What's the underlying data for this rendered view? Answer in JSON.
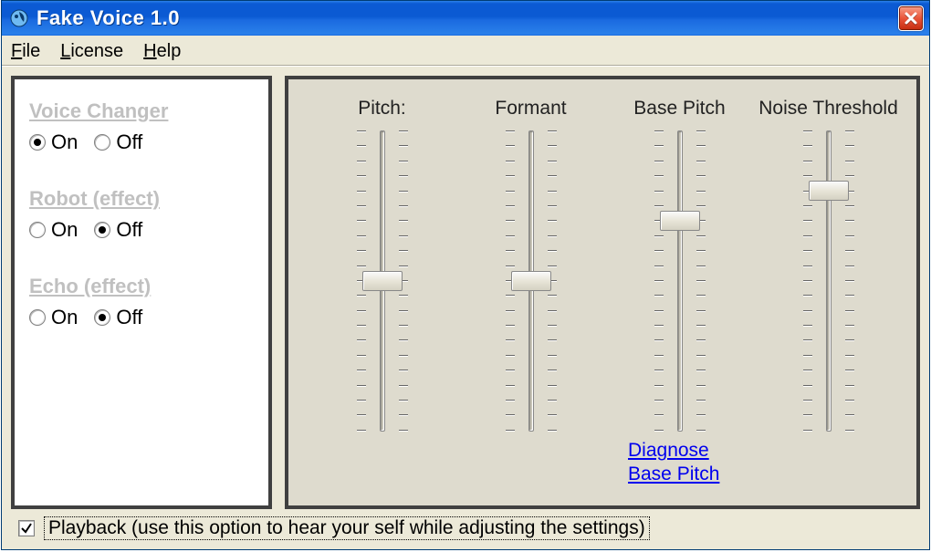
{
  "window": {
    "title": "Fake Voice 1.0"
  },
  "menu": {
    "file": "File",
    "license": "License",
    "help": "Help"
  },
  "left": {
    "voice_changer": {
      "title": "Voice Changer",
      "on": "On",
      "off": "Off",
      "value": "on"
    },
    "robot": {
      "title": "Robot (effect)",
      "on": "On",
      "off": "Off",
      "value": "off"
    },
    "echo": {
      "title": "Echo (effect)",
      "on": "On",
      "off": "Off",
      "value": "off"
    }
  },
  "sliders": {
    "pitch": {
      "label": "Pitch:",
      "position": 0.5
    },
    "formant": {
      "label": "Formant",
      "position": 0.5
    },
    "basepitch": {
      "label": "Base Pitch",
      "position": 0.3
    },
    "noise": {
      "label": "Noise Threshold",
      "position": 0.2
    }
  },
  "links": {
    "diagnose_line1": "Diagnose",
    "diagnose_line2": "Base Pitch"
  },
  "footer": {
    "playback_checked": true,
    "playback_label": "Playback (use this option to hear your self while adjusting the settings)"
  }
}
